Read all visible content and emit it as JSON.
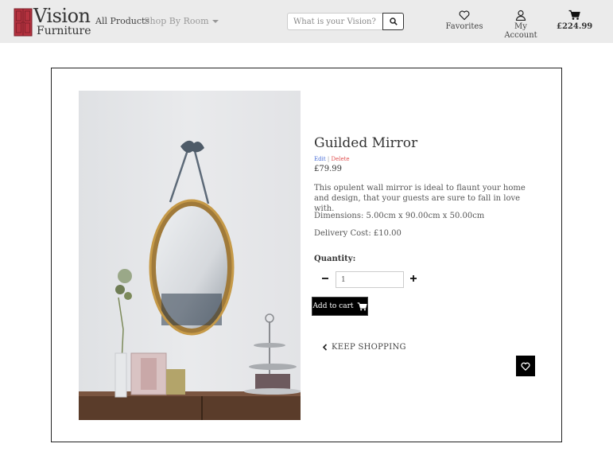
{
  "header": {
    "logo_line1": "Vision",
    "logo_line2": "Furniture",
    "nav_all_products": "All Products",
    "nav_shop_by_room": "Shop By Room",
    "search_placeholder": "What is your Vision?",
    "favorites_label": "Favorites",
    "account_label": "My Account",
    "cart_total": "£224.99",
    "icons": [
      "heart-icon",
      "user-icon",
      "cart-icon",
      "search-icon"
    ]
  },
  "product": {
    "name": "Guilded Mirror",
    "edit_label": "Edit",
    "separator": "|",
    "delete_label": "Delete",
    "price": "£79.99",
    "description": "This opulent wall mirror is ideal to flaunt your home and design, that your guests are sure to fall in love with.",
    "dimensions": "Dimensions: 5.00cm x 90.00cm x 50.00cm",
    "delivery": "Delivery Cost: £10.00",
    "quantity_label": "Quantity:",
    "quantity_value": "1",
    "add_to_cart_label": "Add to cart",
    "keep_shopping_label": "KEEP SHOPPING"
  },
  "colors": {
    "header_bg": "#ebebeb",
    "logo_red": "#b5323f",
    "edit_link": "#4a6fd8",
    "delete_link": "#e05050",
    "button_bg": "#000000"
  }
}
